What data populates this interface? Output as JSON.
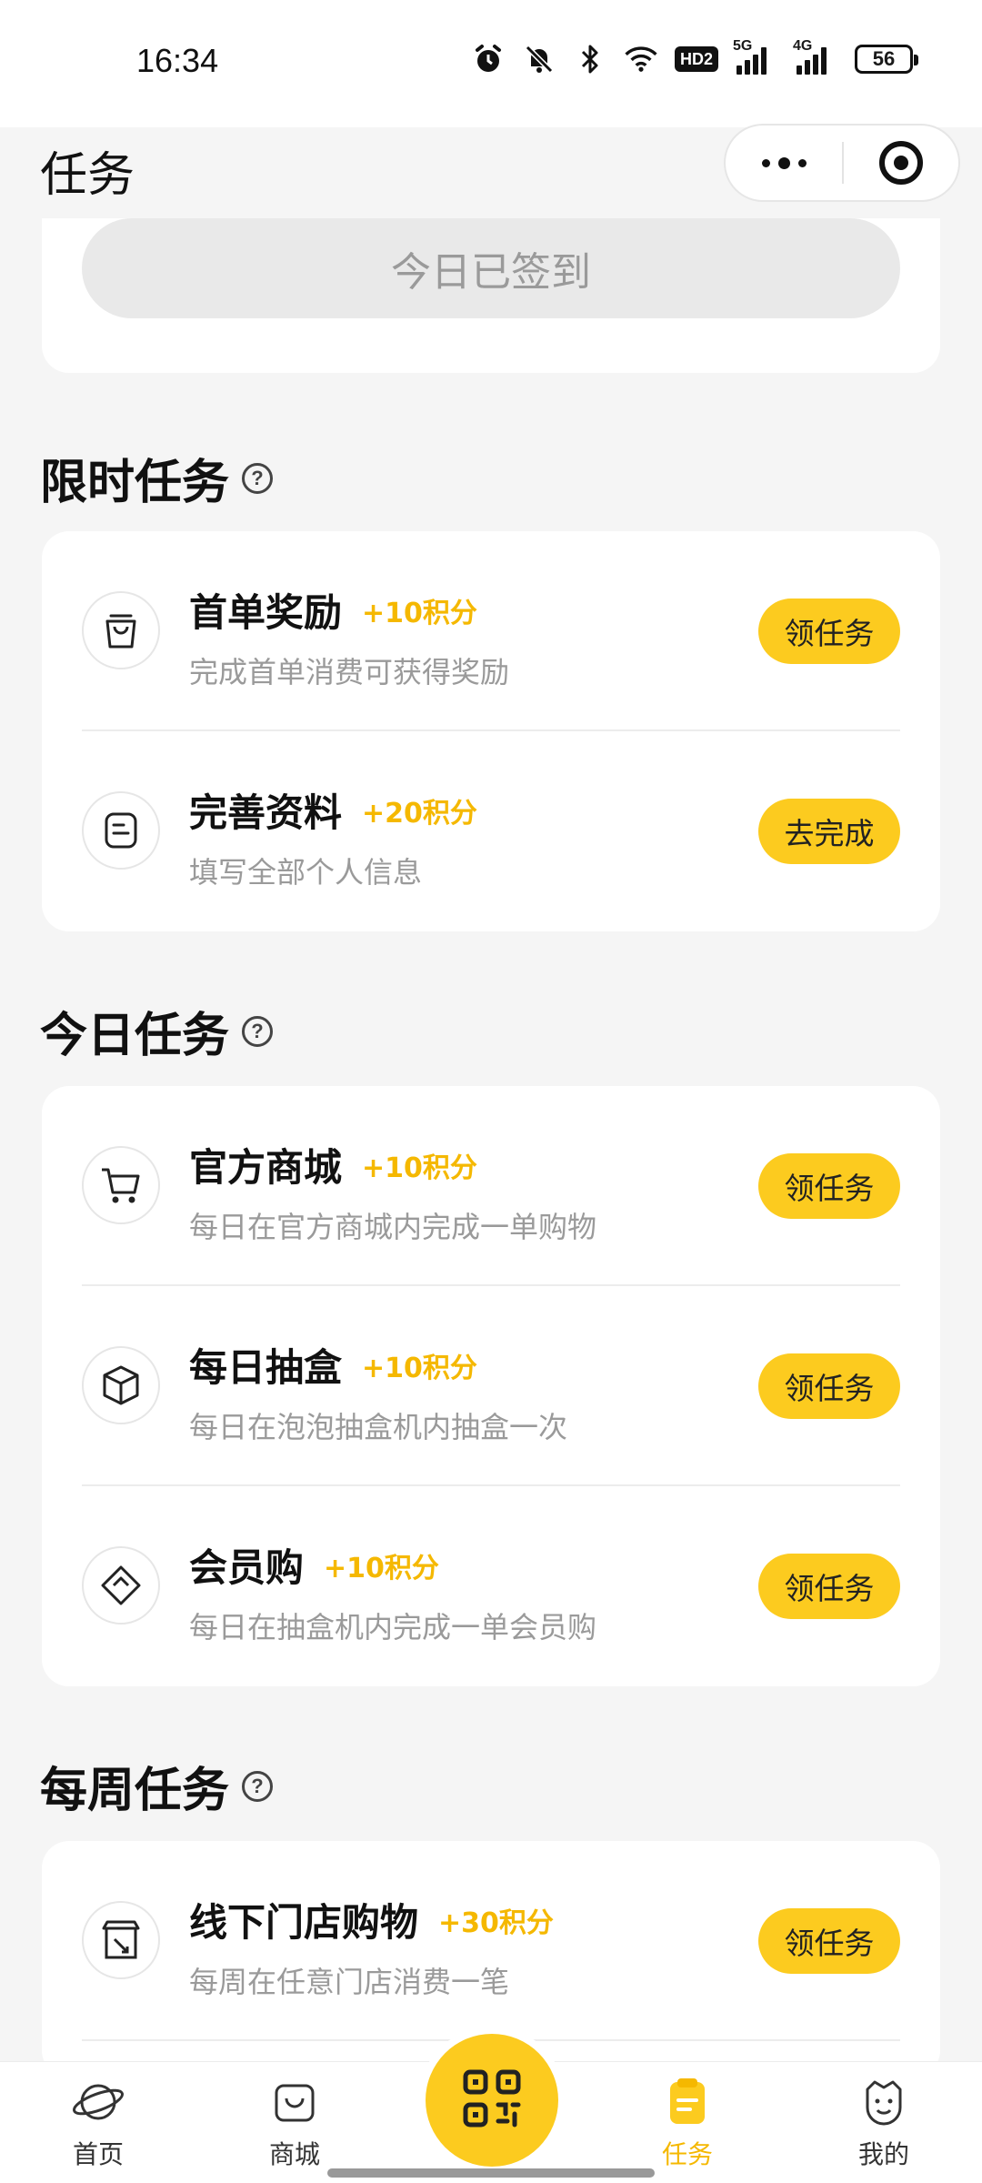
{
  "status_bar": {
    "time": "16:34",
    "hd_label": "HD2",
    "net1_label": "5G",
    "net2_label": "4G",
    "battery": "56"
  },
  "nav": {
    "title": "任务"
  },
  "signin": {
    "button_label": "今日已签到"
  },
  "sections": {
    "limited": {
      "title": "限时任务",
      "tasks": [
        {
          "name": "首单奖励",
          "points": "+10积分",
          "desc": "完成首单消费可获得奖励",
          "button": "领任务",
          "icon": "shopping-bag-icon"
        },
        {
          "name": "完善资料",
          "points": "+20积分",
          "desc": "填写全部个人信息",
          "button": "去完成",
          "icon": "profile-form-icon"
        }
      ]
    },
    "daily": {
      "title": "今日任务",
      "tasks": [
        {
          "name": "官方商城",
          "points": "+10积分",
          "desc": "每日在官方商城内完成一单购物",
          "button": "领任务",
          "icon": "cart-icon"
        },
        {
          "name": "每日抽盒",
          "points": "+10积分",
          "desc": "每日在泡泡抽盒机内抽盒一次",
          "button": "领任务",
          "icon": "box-icon"
        },
        {
          "name": "会员购",
          "points": "+10积分",
          "desc": "每日在抽盒机内完成一单会员购",
          "button": "领任务",
          "icon": "diamond-tag-icon"
        }
      ]
    },
    "weekly": {
      "title": "每周任务",
      "tasks": [
        {
          "name": "线下门店购物",
          "points": "+30积分",
          "desc": "每周在任意门店消费一笔",
          "button": "领任务",
          "icon": "store-icon"
        }
      ]
    }
  },
  "tab_bar": {
    "items": [
      {
        "label": "首页",
        "icon": "planet-icon"
      },
      {
        "label": "商城",
        "icon": "mall-bag-icon"
      },
      {
        "label": "任务",
        "icon": "task-icon",
        "active": true
      },
      {
        "label": "我的",
        "icon": "profile-face-icon"
      }
    ],
    "center_icon": "qr-scan-icon"
  },
  "colors": {
    "accent": "#fccb1f",
    "points_text": "#f5b800",
    "background": "#f5f5f5"
  }
}
